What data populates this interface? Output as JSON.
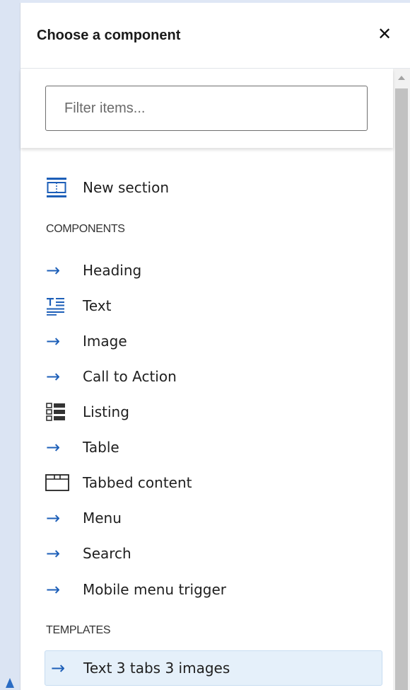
{
  "dialog": {
    "title": "Choose a component",
    "close_symbol": "✕"
  },
  "filter": {
    "placeholder": "Filter items..."
  },
  "new_section": {
    "label": "New section",
    "icon": "section-icon"
  },
  "components": {
    "heading": "COMPONENTS",
    "items": [
      {
        "label": "Heading",
        "icon": "arrow-right-icon"
      },
      {
        "label": "Text",
        "icon": "text-icon"
      },
      {
        "label": "Image",
        "icon": "arrow-right-icon"
      },
      {
        "label": "Call to Action",
        "icon": "arrow-right-icon"
      },
      {
        "label": "Listing",
        "icon": "listing-icon"
      },
      {
        "label": "Table",
        "icon": "arrow-right-icon"
      },
      {
        "label": "Tabbed content",
        "icon": "tabs-icon"
      },
      {
        "label": "Menu",
        "icon": "arrow-right-icon"
      },
      {
        "label": "Search",
        "icon": "arrow-right-icon"
      },
      {
        "label": "Mobile menu trigger",
        "icon": "arrow-right-icon"
      }
    ]
  },
  "templates": {
    "heading": "TEMPLATES",
    "items": [
      {
        "label": "Text 3 tabs 3 images",
        "icon": "arrow-right-icon",
        "selected": true
      }
    ]
  },
  "colors": {
    "accent": "#1d5fb8",
    "selected_bg": "#e5f0fa"
  }
}
